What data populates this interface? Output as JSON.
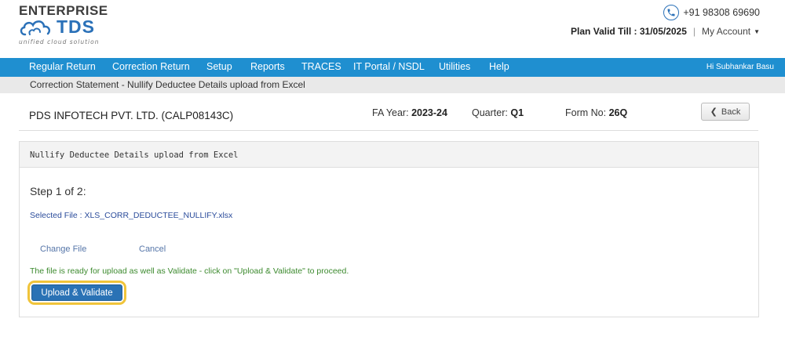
{
  "brand": {
    "line1": "ENTERPRISE",
    "line2": "TDS",
    "tagline": "unified cloud solution"
  },
  "header": {
    "phone": "+91 98308 69690",
    "plan_valid": "Plan Valid Till : 31/05/2025",
    "separator": "|",
    "my_account": "My Account"
  },
  "nav": {
    "items": [
      "Regular Return",
      "Correction Return",
      "Setup",
      "Reports",
      "TRACES",
      "IT Portal / NSDL",
      "Utilities",
      "Help"
    ],
    "user": "Hi Subhankar Basu"
  },
  "breadcrumb": "Correction Statement - Nullify Deductee Details upload from Excel",
  "company": {
    "name": "PDS INFOTECH PVT. LTD. (CALP08143C)",
    "fa_year_label": "FA Year:",
    "fa_year": "2023-24",
    "quarter_label": "Quarter:",
    "quarter": "Q1",
    "form_label": "Form No:",
    "form": "26Q",
    "back_label": "Back"
  },
  "panel": {
    "title": "Nullify Deductee Details upload from Excel",
    "step": "Step 1 of 2:",
    "selected_file": "Selected File : XLS_CORR_DEDUCTEE_NULLIFY.xlsx",
    "change_file": "Change File",
    "cancel": "Cancel",
    "ready_message": "The file is ready for upload as well as Validate - click on \"Upload & Validate\" to proceed.",
    "upload_button": "Upload & Validate"
  },
  "colors": {
    "nav_bg": "#1f8fd0",
    "primary_button": "#2a72b5",
    "highlight_ring": "#f0c43a",
    "success_text": "#3c8a2e"
  }
}
